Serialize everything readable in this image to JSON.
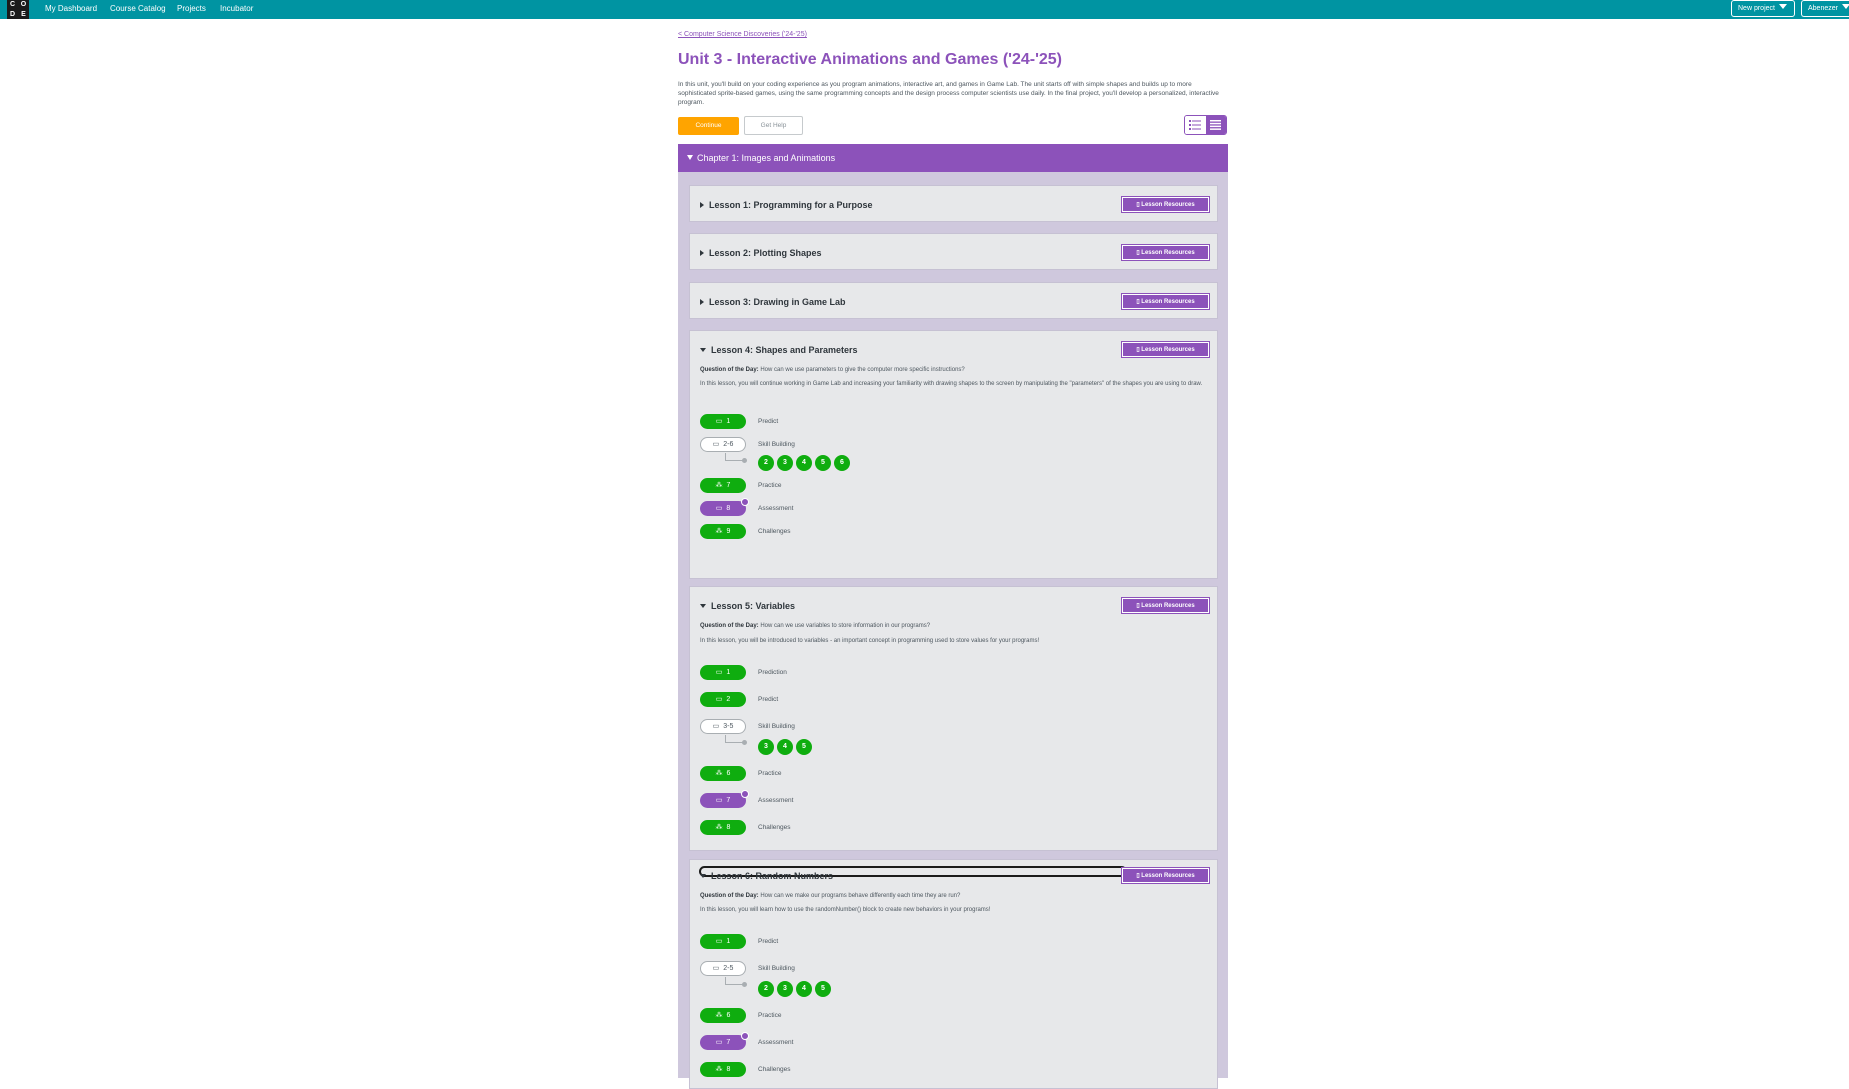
{
  "nav": {
    "logo_letters": [
      "C",
      "O",
      "D",
      "E"
    ],
    "links": [
      "My Dashboard",
      "Course Catalog",
      "Projects",
      "Incubator"
    ],
    "new_project": "New project",
    "user": "Abenezer"
  },
  "header": {
    "breadcrumb": "< Computer Science Discoveries ('24-'25)",
    "title": "Unit 3 - Interactive Animations and Games ('24-'25)",
    "description": "In this unit, you'll build on your coding experience as you program animations, interactive art, and games in Game Lab. The unit starts off with simple shapes and builds up to more sophisticated sprite-based games, using the same programming concepts and the design process computer scientists use daily. In the final project, you'll develop a personalized, interactive program.",
    "continue": "Continue",
    "get_help": "Get Help"
  },
  "chapter": {
    "title": "Chapter 1: Images and Animations",
    "resources_label": "Lesson Resources",
    "qod_label": "Question of the Day:",
    "lessons": [
      {
        "title": "Lesson 1: Programming for a Purpose"
      },
      {
        "title": "Lesson 2: Plotting Shapes"
      },
      {
        "title": "Lesson 3: Drawing in Game Lab"
      },
      {
        "title": "Lesson 4: Shapes and Parameters",
        "question": "How can we use parameters to give the computer more specific instructions?",
        "description": "In this lesson, you will continue working in Game Lab and increasing your familiarity with drawing shapes to the screen by manipulating the \"parameters\" of the shapes you are using to draw.",
        "levels": [
          {
            "num": "1",
            "label": "Predict"
          },
          {
            "num": "2-6",
            "label": "Skill Building",
            "sublevels": [
              "2",
              "3",
              "4",
              "5",
              "6"
            ]
          },
          {
            "num": "7",
            "label": "Practice"
          },
          {
            "num": "8",
            "label": "Assessment"
          },
          {
            "num": "9",
            "label": "Challenges"
          }
        ]
      },
      {
        "title": "Lesson 5: Variables",
        "question": "How can we use variables to store information in our programs?",
        "description": "In this lesson, you will be introduced to variables - an important concept in programming used to store values for your programs!",
        "levels": [
          {
            "num": "1",
            "label": "Prediction"
          },
          {
            "num": "2",
            "label": "Predict"
          },
          {
            "num": "3-5",
            "label": "Skill Building",
            "sublevels": [
              "3",
              "4",
              "5"
            ]
          },
          {
            "num": "6",
            "label": "Practice"
          },
          {
            "num": "7",
            "label": "Assessment"
          },
          {
            "num": "8",
            "label": "Challenges"
          }
        ]
      },
      {
        "title": "Lesson 6: Random Numbers",
        "question": "How can we make our programs behave differently each time they are run?",
        "description": "In this lesson, you will learn how to use the randomNumber() block to create new behaviors in your programs!",
        "levels": [
          {
            "num": "1",
            "label": "Predict"
          },
          {
            "num": "2-5",
            "label": "Skill Building",
            "sublevels": [
              "2",
              "3",
              "4",
              "5"
            ]
          },
          {
            "num": "6",
            "label": "Practice"
          },
          {
            "num": "7",
            "label": "Assessment"
          },
          {
            "num": "8",
            "label": "Challenges"
          }
        ]
      }
    ]
  },
  "icons": {
    "computer": "computer-icon",
    "practice": "people-icon",
    "resources": "document-icon"
  },
  "colors": {
    "teal": "#0094a2",
    "purple": "#8c52ba",
    "green": "#0fad0f",
    "orange": "#ffa400"
  }
}
